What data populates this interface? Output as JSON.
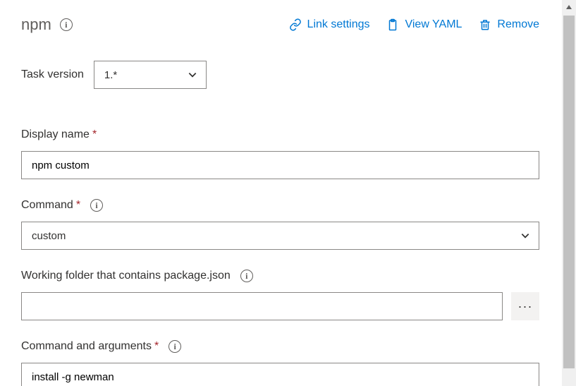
{
  "header": {
    "title": "npm",
    "actions": {
      "link_settings": "Link settings",
      "view_yaml": "View YAML",
      "remove": "Remove"
    }
  },
  "task_version": {
    "label": "Task version",
    "value": "1.*"
  },
  "fields": {
    "display_name": {
      "label": "Display name",
      "value": "npm custom"
    },
    "command": {
      "label": "Command",
      "value": "custom"
    },
    "working_folder": {
      "label": "Working folder that contains package.json",
      "value": ""
    },
    "command_args": {
      "label": "Command and arguments",
      "value": "install -g newman"
    }
  },
  "browse_button": "···"
}
